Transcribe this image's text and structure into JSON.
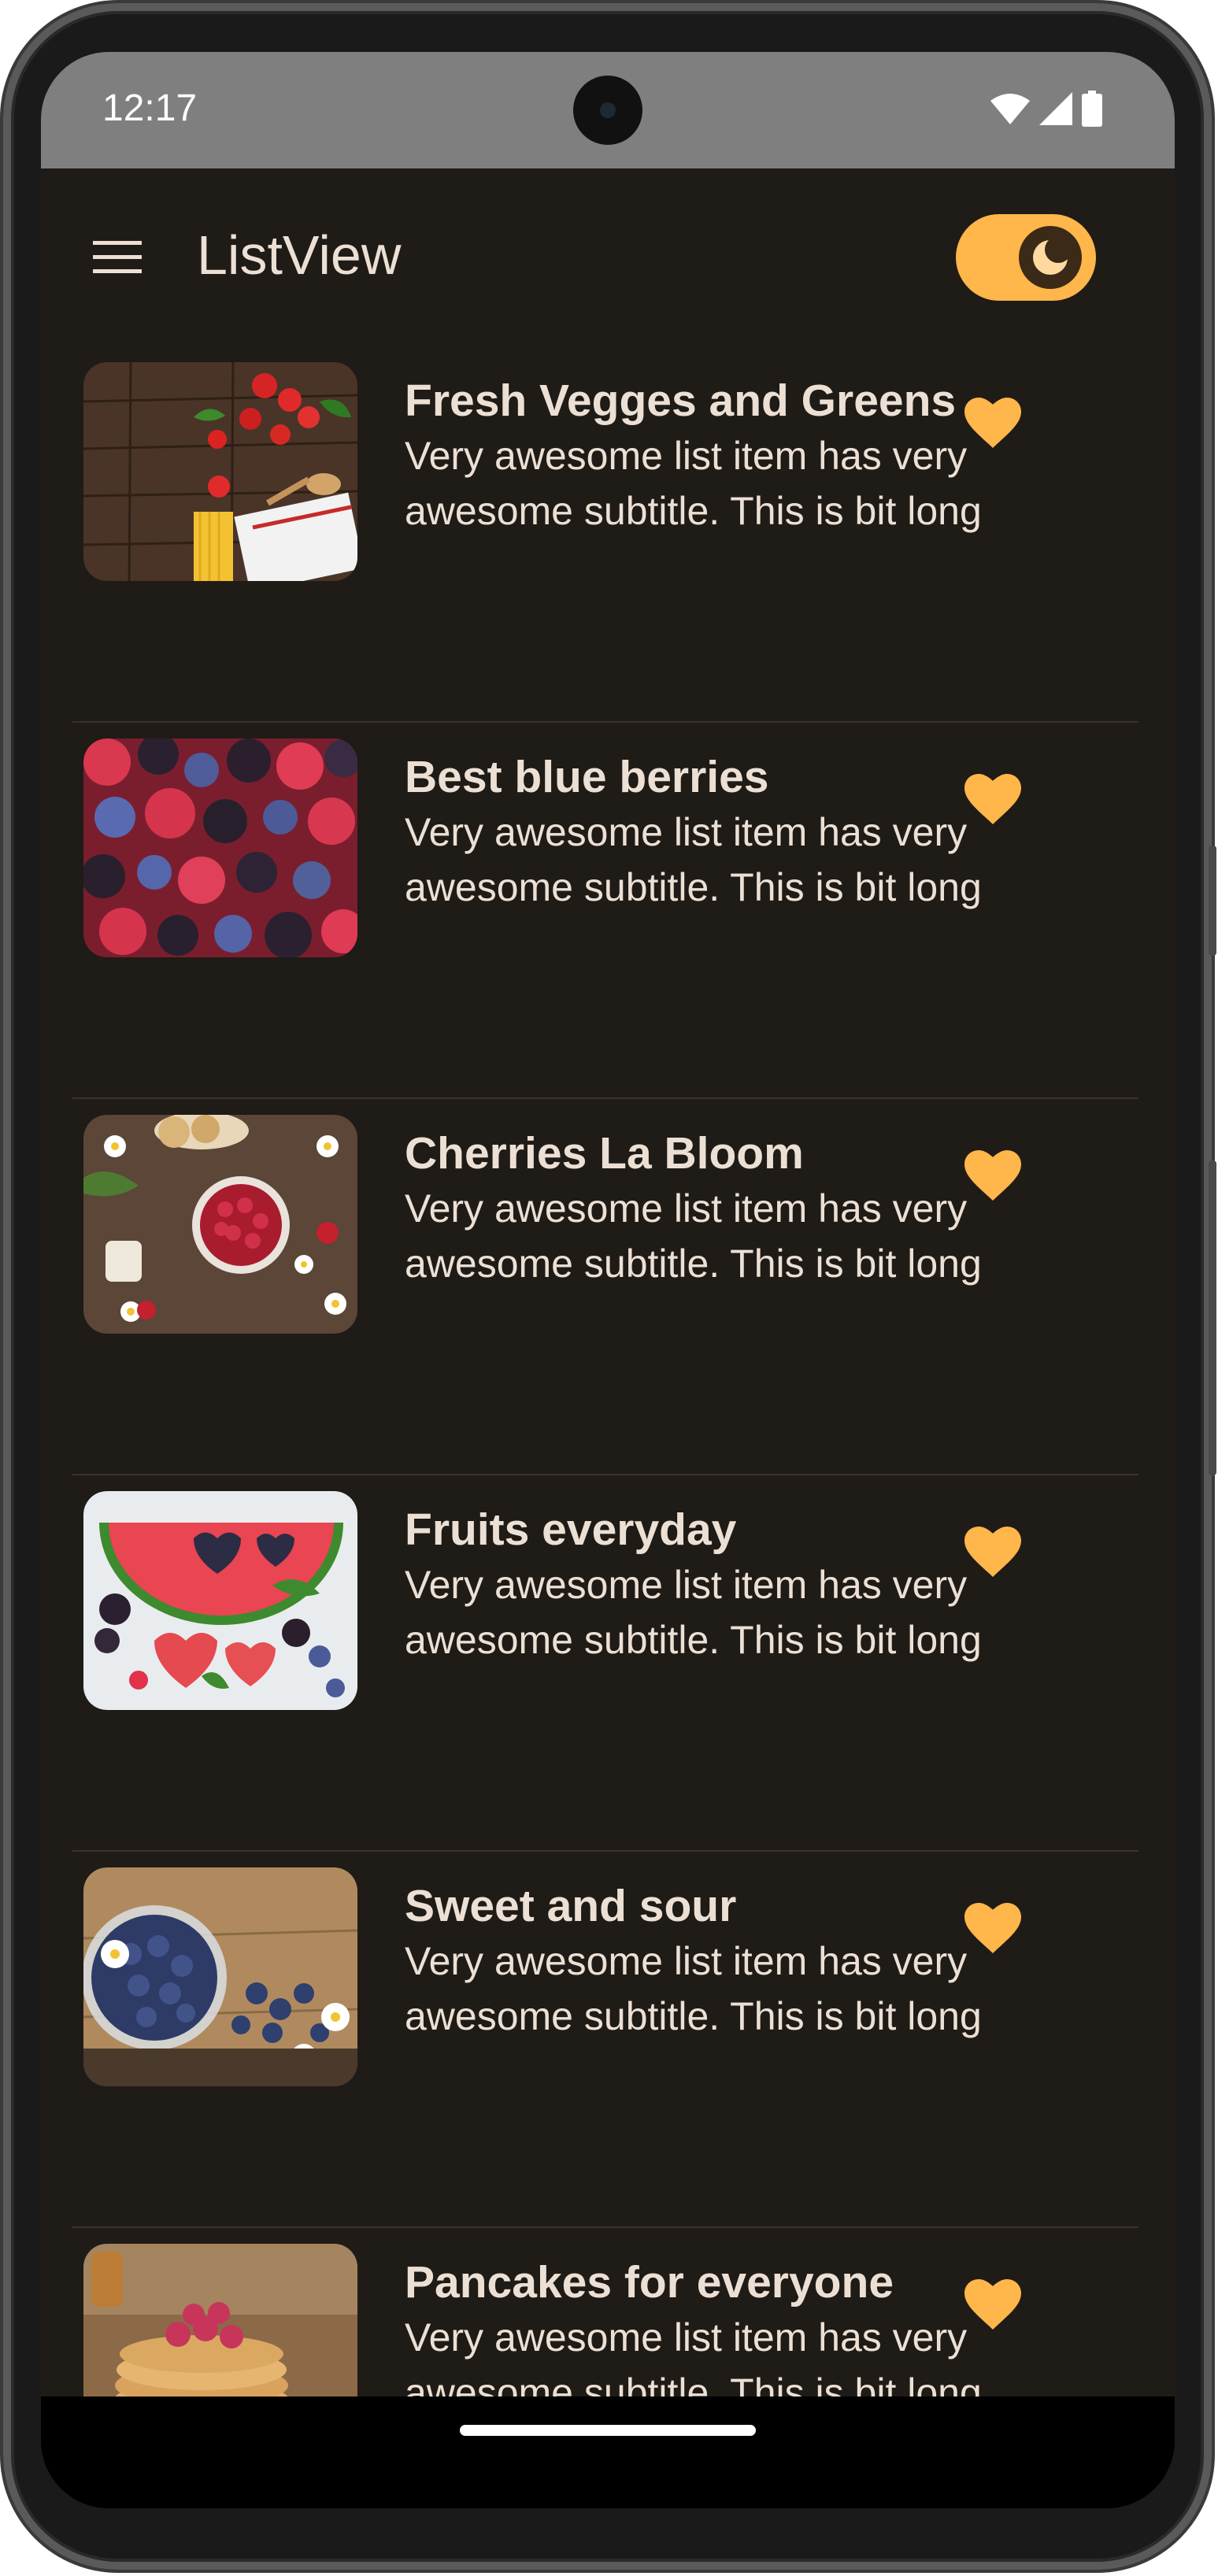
{
  "status_bar": {
    "time": "12:17",
    "wifi_icon": "wifi-icon",
    "signal_icon": "cellular-signal-icon",
    "battery_icon": "battery-icon"
  },
  "app_bar": {
    "title": "ListView",
    "menu_icon": "hamburger-menu-icon",
    "toggle_icon": "moon-icon",
    "dark_mode_enabled": true
  },
  "colors": {
    "accent": "#ffb64a",
    "background": "#1f1b17",
    "text": "#ece0d4",
    "status_bar": "#7f7f7f"
  },
  "list": {
    "items": [
      {
        "title": "Fresh Vegges and Greens",
        "subtitle": "Very awesome list item has very awesome subtitle. This is bit long",
        "image": "vegetables-photo",
        "favorite": true
      },
      {
        "title": "Best blue berries",
        "subtitle": "Very awesome list item has very awesome subtitle. This is bit long",
        "image": "berries-photo",
        "favorite": true
      },
      {
        "title": "Cherries La Bloom",
        "subtitle": "Very awesome list item has very awesome subtitle. This is bit long",
        "image": "raspberries-bowl-photo",
        "favorite": true
      },
      {
        "title": "Fruits everyday",
        "subtitle": "Very awesome list item has very awesome subtitle. This is bit long",
        "image": "watermelon-hearts-photo",
        "favorite": true
      },
      {
        "title": "Sweet and sour",
        "subtitle": "Very awesome list item has very awesome subtitle. This is bit long",
        "image": "blueberries-bowl-photo",
        "favorite": true
      },
      {
        "title": "Pancakes for everyone",
        "subtitle": "Very awesome list item has very awesome subtitle. This is bit long",
        "image": "pancakes-photo",
        "favorite": true
      }
    ]
  }
}
